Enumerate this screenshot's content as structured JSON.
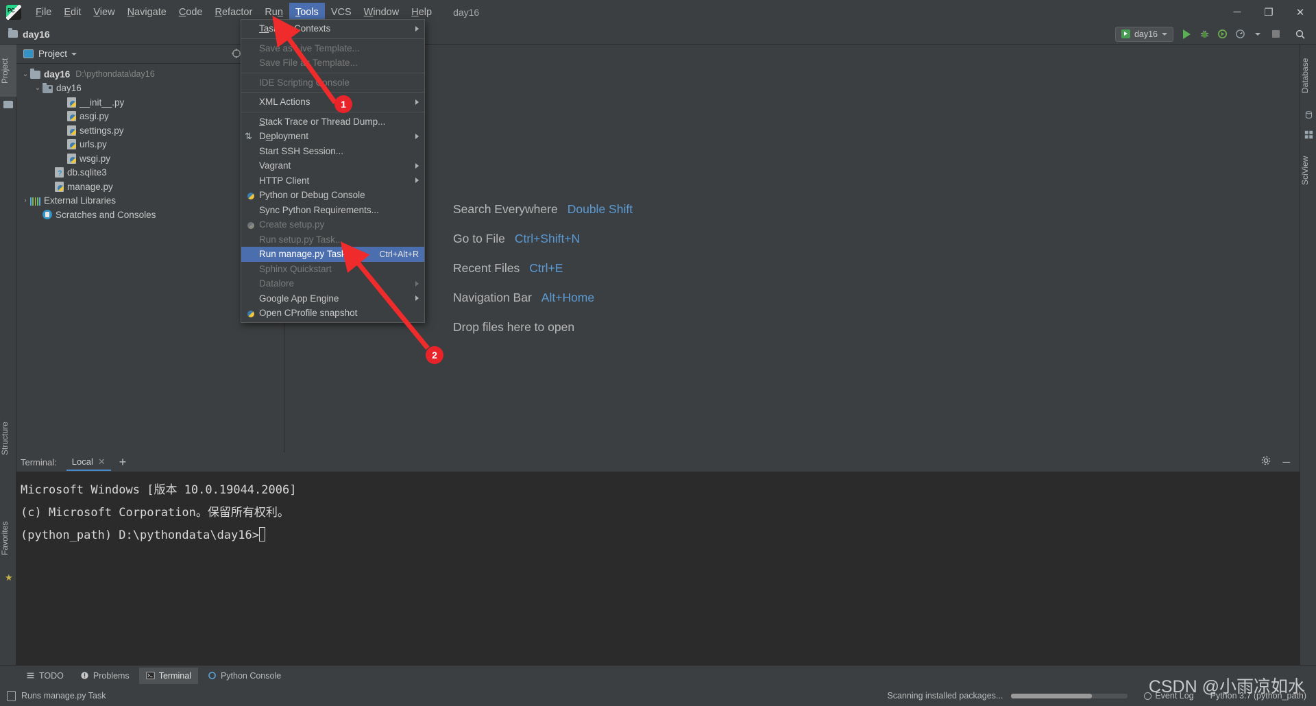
{
  "app": {
    "logo_icon": "pycharm-logo-icon",
    "project_name": "day16"
  },
  "menubar": {
    "items": [
      {
        "label": "File",
        "mnemonic": "F"
      },
      {
        "label": "Edit",
        "mnemonic": "E"
      },
      {
        "label": "View",
        "mnemonic": "V"
      },
      {
        "label": "Navigate",
        "mnemonic": "N"
      },
      {
        "label": "Code",
        "mnemonic": "C"
      },
      {
        "label": "Refactor",
        "mnemonic": "R"
      },
      {
        "label": "Run",
        "mnemonic": "n"
      },
      {
        "label": "Tools",
        "mnemonic": "T",
        "active": true
      },
      {
        "label": "VCS",
        "mnemonic": ""
      },
      {
        "label": "Window",
        "mnemonic": "W"
      },
      {
        "label": "Help",
        "mnemonic": "H"
      }
    ],
    "window_controls": {
      "minimize": "─",
      "maximize": "❐",
      "close": "✕"
    }
  },
  "navbar": {
    "breadcrumb": "day16",
    "run_config": "day16",
    "buttons": {
      "run": "run-icon",
      "debug": "debug-icon",
      "coverage": "run-coverage-icon",
      "profile": "profile-icon",
      "stop": "stop-icon",
      "search": "search-icon"
    }
  },
  "left_strip": {
    "project_tab": "Project",
    "structure_tab": "Structure",
    "favorites_tab": "Favorites"
  },
  "right_strip": {
    "database_tab": "Database",
    "sciview_tab": "SciView"
  },
  "project_panel": {
    "title": "Project",
    "actions": {
      "settings": "target-icon",
      "expand_all": "expand-all-icon",
      "collapse_all": "collapse-all-icon"
    },
    "tree": [
      {
        "label": "day16",
        "path": "D:\\pythondata\\day16",
        "icon": "folder-icon",
        "indent": 0,
        "twist": "⌄",
        "bold": true
      },
      {
        "label": "day16",
        "path": "",
        "icon": "source-folder-icon",
        "indent": 1,
        "twist": "⌄",
        "bold": false
      },
      {
        "label": "__init__.py",
        "path": "",
        "icon": "python-file-icon",
        "indent": 3,
        "twist": "",
        "bold": false
      },
      {
        "label": "asgi.py",
        "path": "",
        "icon": "python-file-icon",
        "indent": 3,
        "twist": "",
        "bold": false
      },
      {
        "label": "settings.py",
        "path": "",
        "icon": "python-file-icon",
        "indent": 3,
        "twist": "",
        "bold": false
      },
      {
        "label": "urls.py",
        "path": "",
        "icon": "python-file-icon",
        "indent": 3,
        "twist": "",
        "bold": false
      },
      {
        "label": "wsgi.py",
        "path": "",
        "icon": "python-file-icon",
        "indent": 3,
        "twist": "",
        "bold": false
      },
      {
        "label": "db.sqlite3",
        "path": "",
        "icon": "database-file-icon",
        "indent": 2,
        "twist": "",
        "bold": false
      },
      {
        "label": "manage.py",
        "path": "",
        "icon": "python-file-icon",
        "indent": 2,
        "twist": "",
        "bold": false
      },
      {
        "label": "External Libraries",
        "path": "",
        "icon": "libraries-icon",
        "indent": 0,
        "twist": "›",
        "bold": false
      },
      {
        "label": "Scratches and Consoles",
        "path": "",
        "icon": "scratches-icon",
        "indent": 1,
        "twist": "",
        "bold": false
      }
    ]
  },
  "tools_menu": {
    "items": [
      {
        "label": "Tasks & Contexts",
        "mnemonic": "Ta",
        "submenu": true,
        "disabled": false,
        "selected": false,
        "icon": "",
        "shortcut": "",
        "sep_after": true
      },
      {
        "label": "Save as Live Template...",
        "submenu": false,
        "disabled": true,
        "selected": false,
        "icon": "",
        "shortcut": "",
        "sep_after": false
      },
      {
        "label": "Save File as Template...",
        "submenu": false,
        "disabled": true,
        "selected": false,
        "icon": "",
        "shortcut": "",
        "sep_after": true
      },
      {
        "label": "IDE Scripting Console",
        "submenu": false,
        "disabled": true,
        "selected": false,
        "icon": "",
        "shortcut": "",
        "sep_after": true
      },
      {
        "label": "XML Actions",
        "submenu": true,
        "disabled": false,
        "selected": false,
        "icon": "",
        "shortcut": "",
        "sep_after": true
      },
      {
        "label": "Stack Trace or Thread Dump...",
        "submenu": false,
        "disabled": false,
        "selected": false,
        "icon": "",
        "shortcut": "",
        "sep_after": false
      },
      {
        "label": "Deployment",
        "submenu": true,
        "disabled": false,
        "selected": false,
        "icon": "deployment-icon",
        "shortcut": "",
        "sep_after": false
      },
      {
        "label": "Start SSH Session...",
        "submenu": false,
        "disabled": false,
        "selected": false,
        "icon": "",
        "shortcut": "",
        "sep_after": false
      },
      {
        "label": "Vagrant",
        "submenu": true,
        "disabled": false,
        "selected": false,
        "icon": "",
        "shortcut": "",
        "sep_after": false
      },
      {
        "label": "HTTP Client",
        "submenu": true,
        "disabled": false,
        "selected": false,
        "icon": "",
        "shortcut": "",
        "sep_after": false
      },
      {
        "label": "Python or Debug Console",
        "submenu": false,
        "disabled": false,
        "selected": false,
        "icon": "python-icon",
        "shortcut": "",
        "sep_after": false
      },
      {
        "label": "Sync Python Requirements...",
        "submenu": false,
        "disabled": false,
        "selected": false,
        "icon": "",
        "shortcut": "",
        "sep_after": false
      },
      {
        "label": "Create setup.py",
        "submenu": false,
        "disabled": true,
        "selected": false,
        "icon": "python-icon-disabled",
        "shortcut": "",
        "sep_after": false
      },
      {
        "label": "Run setup.py Task...",
        "submenu": false,
        "disabled": true,
        "selected": false,
        "icon": "",
        "shortcut": "",
        "sep_after": false
      },
      {
        "label": "Run manage.py Task...",
        "submenu": false,
        "disabled": false,
        "selected": true,
        "icon": "",
        "shortcut": "Ctrl+Alt+R",
        "sep_after": false
      },
      {
        "label": "Sphinx Quickstart",
        "submenu": false,
        "disabled": true,
        "selected": false,
        "icon": "",
        "shortcut": "",
        "sep_after": false
      },
      {
        "label": "Datalore",
        "submenu": true,
        "disabled": true,
        "selected": false,
        "icon": "",
        "shortcut": "",
        "sep_after": false
      },
      {
        "label": "Google App Engine",
        "submenu": true,
        "disabled": false,
        "selected": false,
        "icon": "",
        "shortcut": "",
        "sep_after": false
      },
      {
        "label": "Open CProfile snapshot",
        "submenu": false,
        "disabled": false,
        "selected": false,
        "icon": "cprofile-icon",
        "shortcut": "",
        "sep_after": false
      }
    ]
  },
  "editor": {
    "welcome_rows": [
      {
        "label": "Search Everywhere",
        "key": "Double Shift"
      },
      {
        "label": "Go to File",
        "key": "Ctrl+Shift+N"
      },
      {
        "label": "Recent Files",
        "key": "Ctrl+E"
      },
      {
        "label": "Navigation Bar",
        "key": "Alt+Home"
      }
    ],
    "drop_hint": "Drop files here to open"
  },
  "terminal": {
    "title": "Terminal:",
    "tab": "Local",
    "close_icon": "close-icon",
    "add_icon": "plus-icon",
    "settings_icon": "gear-icon",
    "minimize_icon": "minimize-icon",
    "lines": [
      "Microsoft Windows [版本 10.0.19044.2006]",
      "(c) Microsoft Corporation。保留所有权利。",
      "",
      "(python_path) D:\\pythondata\\day16>"
    ]
  },
  "bottom_tabs": [
    {
      "label": "TODO",
      "icon": "todo-icon",
      "active": false
    },
    {
      "label": "Problems",
      "icon": "problems-icon",
      "active": false
    },
    {
      "label": "Terminal",
      "icon": "terminal-icon",
      "active": true
    },
    {
      "label": "Python Console",
      "icon": "python-console-icon",
      "active": false
    }
  ],
  "status_bar": {
    "message": "Runs manage.py Task",
    "progress_text": "Scanning installed packages...",
    "progress_percent": 69,
    "event_log": "Event Log",
    "interpreter": "Python 3.7 (python_path)"
  },
  "annotations": [
    {
      "id": "1",
      "label": "1"
    },
    {
      "id": "2",
      "label": "2"
    }
  ],
  "watermark": "CSDN @小雨凉如水",
  "colors": {
    "accent_blue": "#4b6eaf",
    "link_blue": "#5a9bd5",
    "annotation_red": "#e8232a",
    "panel_bg": "#3c3f41",
    "terminal_bg": "#2b2b2b"
  }
}
